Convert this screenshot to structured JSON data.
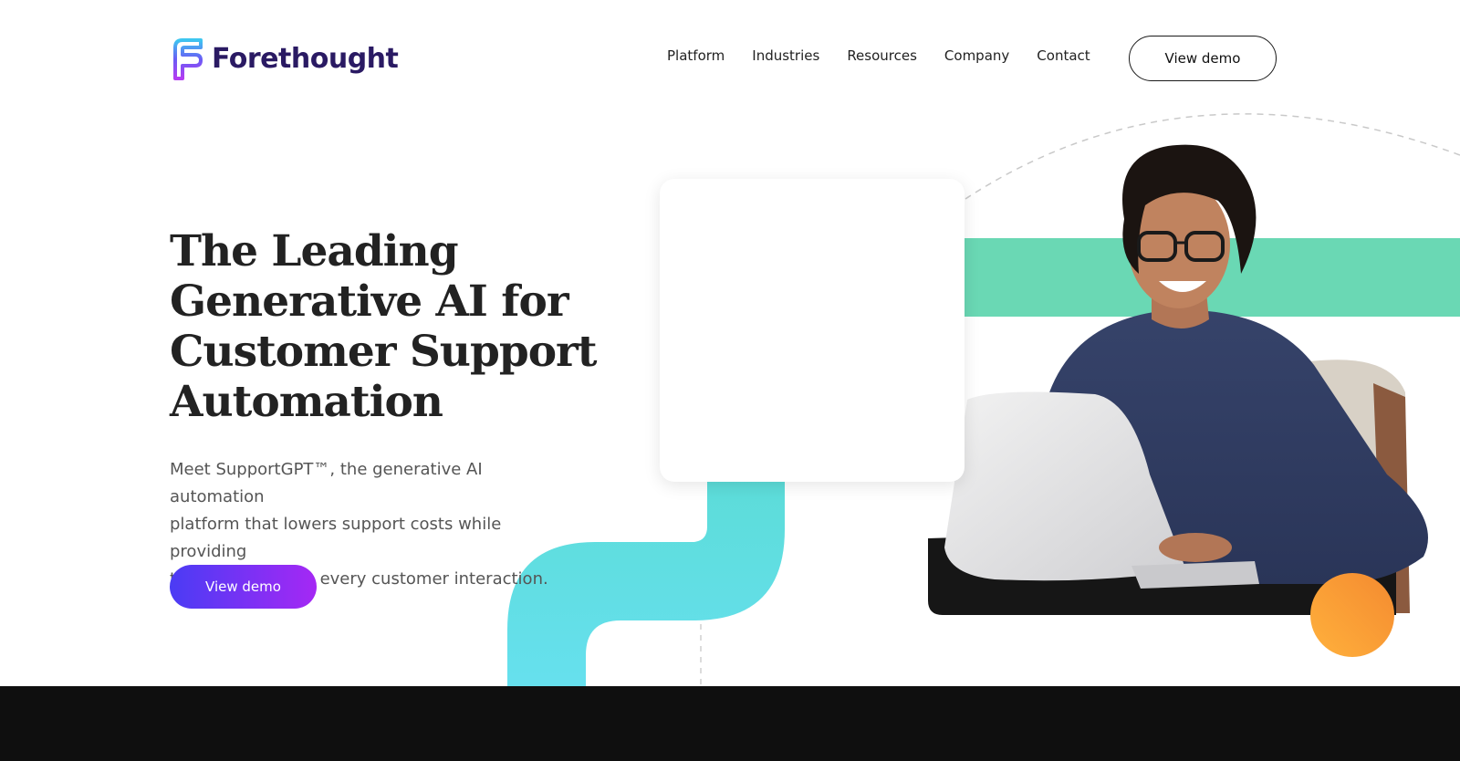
{
  "brand": {
    "name": "Forethought",
    "color": "#2a1a63"
  },
  "nav": {
    "items": [
      {
        "label": "Platform"
      },
      {
        "label": "Industries"
      },
      {
        "label": "Resources"
      },
      {
        "label": "Company"
      },
      {
        "label": "Contact"
      }
    ],
    "cta_label": "View demo"
  },
  "hero": {
    "title_lines": [
      "The Leading",
      "Generative AI for",
      "Customer Support",
      "Automation"
    ],
    "description_lines": [
      "Meet SupportGPT™, the generative AI automation",
      "platform that lowers support costs while providing",
      "top-tier service in every customer interaction."
    ],
    "cta_label": "View demo"
  },
  "colors": {
    "accent_gradient_start": "#4a3cf4",
    "accent_gradient_end": "#a528f4",
    "teal_band": "#6ad8b4",
    "cyan_path": "#5fdde4",
    "orange_circle": "#f8a134",
    "footer_band": "#0f0f0f"
  },
  "icons": {
    "logo": "forethought-logo-icon"
  }
}
